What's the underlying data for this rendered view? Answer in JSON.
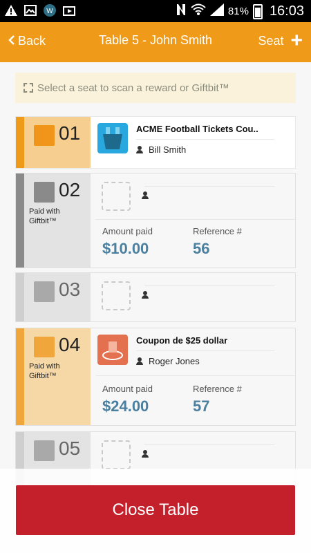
{
  "status_bar": {
    "battery_pct": "81%",
    "time": "16:03",
    "icons": [
      "warning-icon",
      "image-icon",
      "w-app-icon",
      "play-store-icon",
      "nfc-icon",
      "wifi-icon",
      "signal-icon",
      "battery-icon"
    ]
  },
  "header": {
    "back_label": "Back",
    "title": "Table 5 - John Smith",
    "seat_label": "Seat",
    "bg_color": "#f09a1a"
  },
  "hint": {
    "text": "Select a seat to scan a reward or Giftbit™"
  },
  "rows": [
    {
      "seat_number": "01",
      "reward_name": "ACME Football Tickets Cou..",
      "user_name": "Bill  Smith",
      "selected": true
    },
    {
      "seat_number": "02",
      "paid_label_1": "Paid with",
      "paid_label_2": "Giftbit™",
      "amount_label": "Amount paid",
      "amount_value": "$10.00",
      "ref_label": "Reference #",
      "ref_value": "56"
    },
    {
      "seat_number": "03"
    },
    {
      "seat_number": "04",
      "paid_label_1": "Paid with",
      "paid_label_2": "Giftbit™",
      "reward_name": "Coupon de $25 dollar",
      "user_name": "Roger  Jones",
      "amount_label": "Amount paid",
      "amount_value": "$24.00",
      "ref_label": "Reference #",
      "ref_value": "57"
    },
    {
      "seat_number": "05"
    }
  ],
  "footer": {
    "close_label": "Close Table",
    "button_color": "#c3202b"
  }
}
